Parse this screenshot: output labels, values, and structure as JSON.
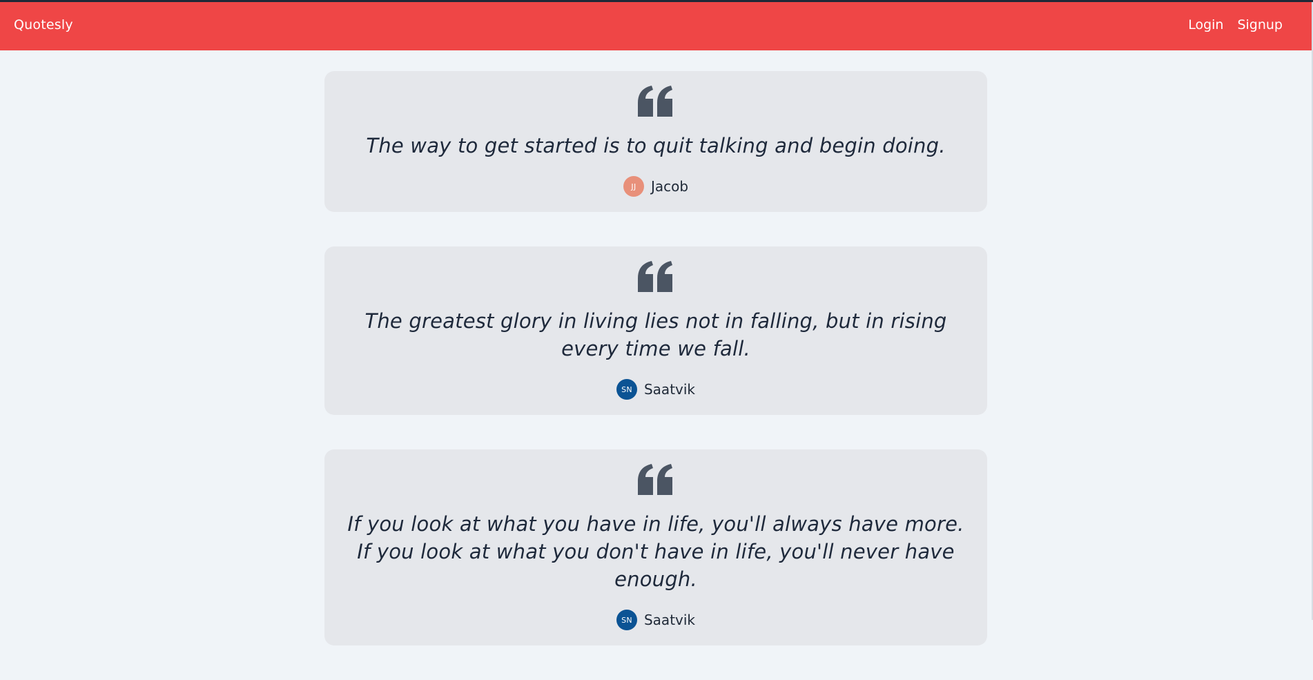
{
  "app": {
    "brand": "Quotesly"
  },
  "nav": {
    "login_label": "Login",
    "signup_label": "Signup"
  },
  "colors": {
    "navbar": "#ef4646",
    "card": "#e5e7eb",
    "quote_icon": "#4b5563"
  },
  "quotes": [
    {
      "text": "The way to get started is to quit talking and begin doing.",
      "author": "Jacob",
      "initials": "JJ",
      "avatar_color": "#e8907a"
    },
    {
      "text": "The greatest glory in living lies not in falling, but in rising every time we fall.",
      "author": "Saatvik",
      "initials": "SN",
      "avatar_color": "#0b5394"
    },
    {
      "text": "If you look at what you have in life, you'll always have more. If you look at what you don't have in life, you'll never have enough.",
      "author": "Saatvik",
      "initials": "SN",
      "avatar_color": "#0b5394"
    }
  ]
}
